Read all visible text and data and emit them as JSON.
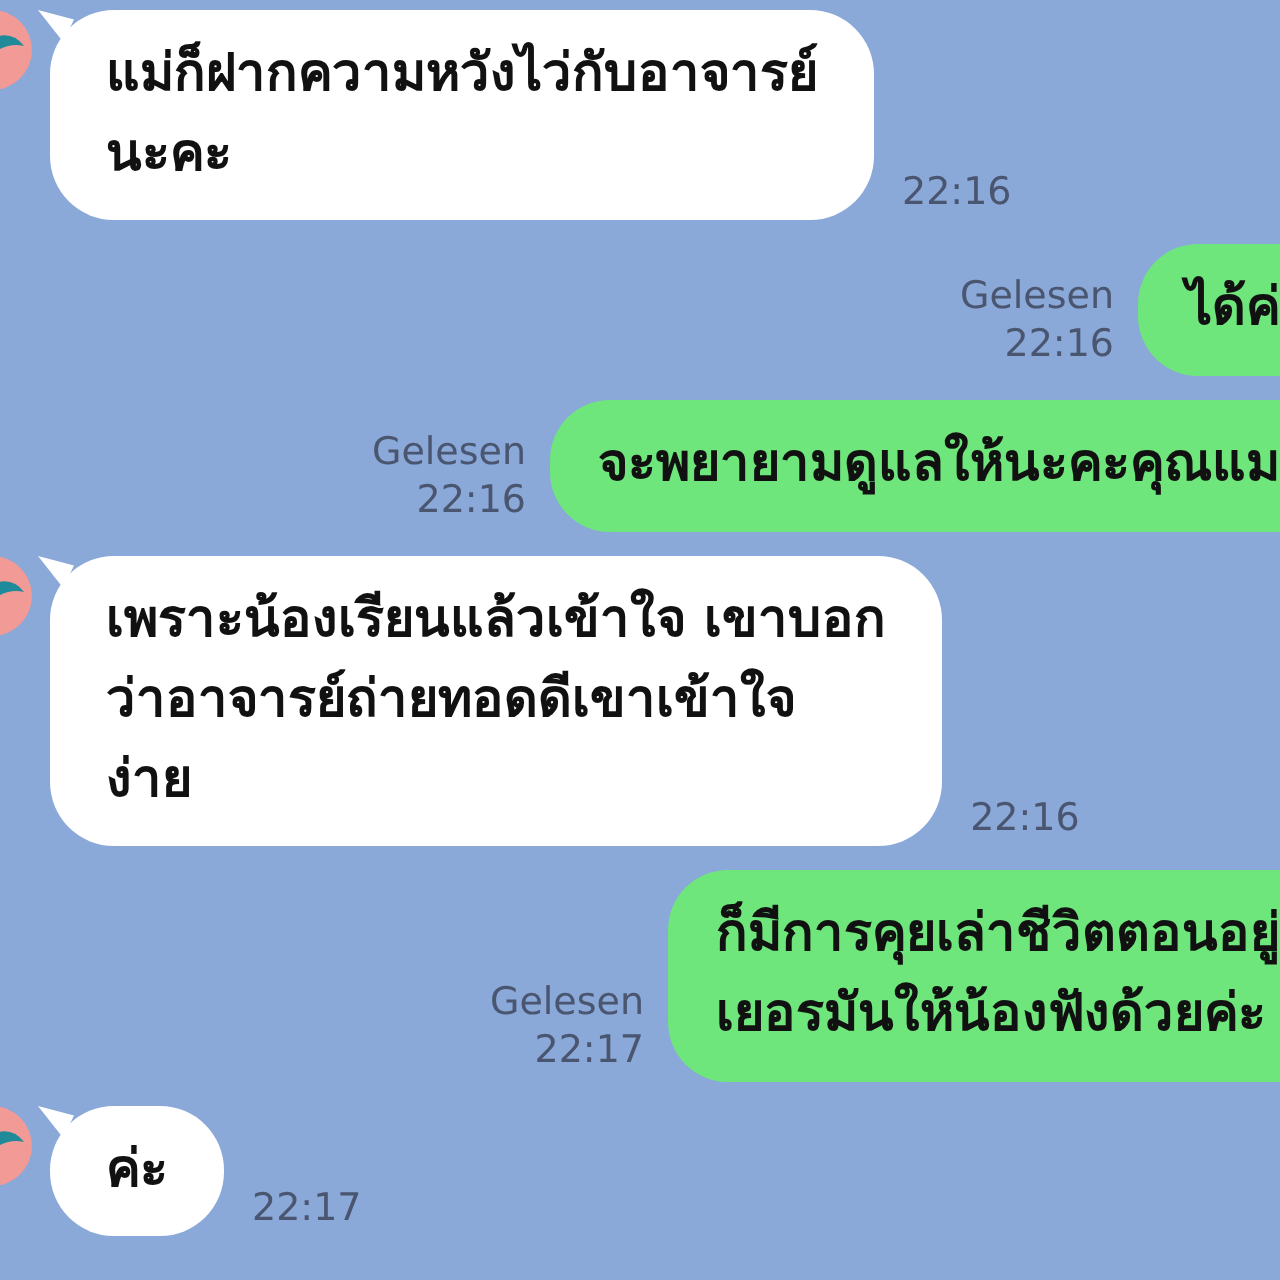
{
  "messages": [
    {
      "kind": "incoming",
      "lines": [
        "แม่ก็ฝากความหวังไว่กับอาจารย์",
        "นะคะ"
      ],
      "time": "22:16"
    },
    {
      "kind": "outgoing",
      "lines": [
        "ได้ค่"
      ],
      "read_label": "Gelesen",
      "time": "22:16"
    },
    {
      "kind": "outgoing",
      "lines": [
        "จะพยายามดูแลให้นะคะคุณแม"
      ],
      "read_label": "Gelesen",
      "time": "22:16"
    },
    {
      "kind": "incoming",
      "lines": [
        "เพราะน้องเรียนแล้วเข้าใจ เขาบอก",
        "ว่าอาจารย์ถ่ายทอดดีเขาเข้าใจ",
        "ง่าย"
      ],
      "time": "22:16"
    },
    {
      "kind": "outgoing",
      "lines": [
        "ก็มีการคุยเล่าชีวิตตอนอยู่",
        "เยอรมันให้น้องฟังด้วยค่ะ"
      ],
      "read_label": "Gelesen",
      "time": "22:17"
    },
    {
      "kind": "incoming",
      "lines": [
        "ค่ะ"
      ],
      "time": "22:17"
    }
  ]
}
